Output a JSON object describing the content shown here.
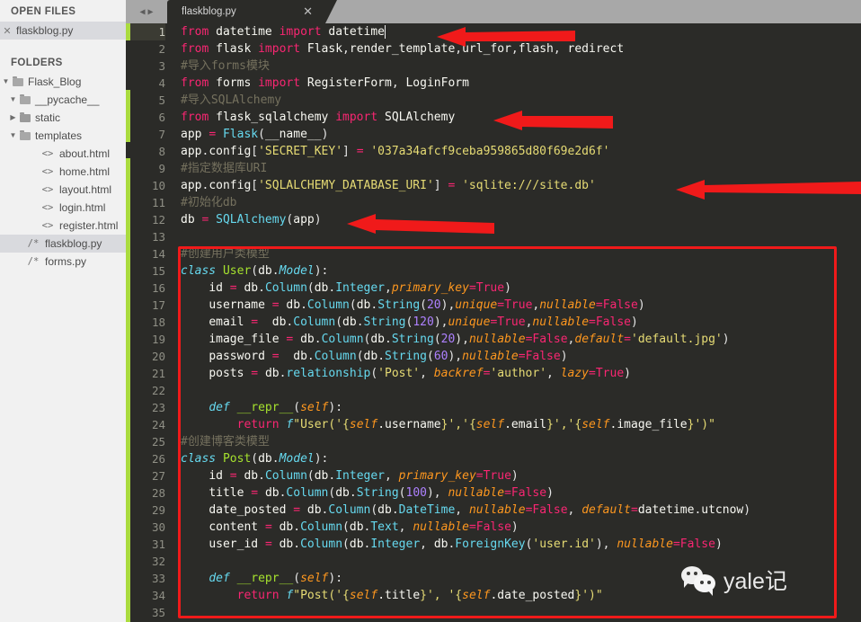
{
  "sidebar": {
    "open_files_title": "OPEN FILES",
    "open_files": [
      {
        "name": "flaskblog.py",
        "close_icon": "close-icon",
        "selected": true
      }
    ],
    "folders_title": "FOLDERS",
    "tree": [
      {
        "label": "Flask_Blog",
        "kind": "folder",
        "depth": 0,
        "expanded": true,
        "icon": "folder-open-icon",
        "triangle": "▼"
      },
      {
        "label": "__pycache__",
        "kind": "folder",
        "depth": 1,
        "expanded": true,
        "icon": "folder-open-icon",
        "triangle": "▼"
      },
      {
        "label": "static",
        "kind": "folder",
        "depth": 1,
        "expanded": false,
        "icon": "folder-closed-icon",
        "triangle": "▶"
      },
      {
        "label": "templates",
        "kind": "folder",
        "depth": 1,
        "expanded": true,
        "icon": "folder-open-icon",
        "triangle": "▼"
      },
      {
        "label": "about.html",
        "kind": "file",
        "depth": 2,
        "icon": "html-file-icon",
        "glyph": "<>"
      },
      {
        "label": "home.html",
        "kind": "file",
        "depth": 2,
        "icon": "html-file-icon",
        "glyph": "<>"
      },
      {
        "label": "layout.html",
        "kind": "file",
        "depth": 2,
        "icon": "html-file-icon",
        "glyph": "<>"
      },
      {
        "label": "login.html",
        "kind": "file",
        "depth": 2,
        "icon": "html-file-icon",
        "glyph": "<>"
      },
      {
        "label": "register.html",
        "kind": "file",
        "depth": 2,
        "icon": "html-file-icon",
        "glyph": "<>"
      },
      {
        "label": "flaskblog.py",
        "kind": "file",
        "depth": 1,
        "icon": "python-file-icon",
        "glyph": "/*",
        "selected": true
      },
      {
        "label": "forms.py",
        "kind": "file",
        "depth": 1,
        "icon": "python-file-icon",
        "glyph": "/*"
      }
    ]
  },
  "tabbar": {
    "nav_back_icon": "chevron-left-icon",
    "nav_forward_icon": "chevron-right-icon",
    "tabs": [
      {
        "label": "flaskblog.py",
        "close_icon": "close-icon",
        "active": true
      }
    ]
  },
  "editor": {
    "first_line": 1,
    "last_line": 35,
    "current_line": 1,
    "cursor_line": 1,
    "cursor_col": 29,
    "line_numbers": [
      "1",
      "2",
      "3",
      "4",
      "5",
      "6",
      "7",
      "8",
      "9",
      "10",
      "11",
      "12",
      "13",
      "14",
      "15",
      "16",
      "17",
      "18",
      "19",
      "20",
      "21",
      "22",
      "23",
      "24",
      "25",
      "26",
      "27",
      "28",
      "29",
      "30",
      "31",
      "32",
      "33",
      "34",
      "35"
    ],
    "lines": [
      "from datetime import datetime",
      "from flask import Flask,render_template,url_for,flash, redirect",
      "#导入forms模块",
      "from forms import RegisterForm, LoginForm",
      "#导入SQLAlchemy",
      "from flask_sqlalchemy import SQLAlchemy",
      "app = Flask(__name__)",
      "app.config['SECRET_KEY'] = '037a34afcf9ceba959865d80f69e2d6f'",
      "#指定数据库URI",
      "app.config['SQLALCHEMY_DATABASE_URI'] = 'sqlite:///site.db'",
      "#初始化db",
      "db = SQLAlchemy(app)",
      "",
      "#创建用户类模型",
      "class User(db.Model):",
      "    id = db.Column(db.Integer,primary_key=True)",
      "    username = db.Column(db.String(20),unique=True,nullable=False)",
      "    email =  db.Column(db.String(120),unique=True,nullable=False)",
      "    image_file = db.Column(db.String(20),nullable=False,default='default.jpg')",
      "    password =  db.Column(db.String(60),nullable=False)",
      "    posts = db.relationship('Post', backref='author', lazy=True)",
      "",
      "    def __repr__(self):",
      "        return f\"User('{self.username}','{self.email}','{self.image_file}')\"",
      "#创建博客类模型",
      "class Post(db.Model):",
      "    id = db.Column(db.Integer, primary_key=True)",
      "    title = db.Column(db.String(100), nullable=False)",
      "    date_posted = db.Column(db.DateTime, nullable=False, default=datetime.utcnow)",
      "    content = db.Column(db.Text, nullable=False)",
      "    user_id = db.Column(db.Integer, db.ForeignKey('user.id'), nullable=False)",
      "",
      "    def __repr__(self):",
      "        return f\"Post('{self.title}', '{self.date_posted}')\"",
      ""
    ]
  },
  "annotations": {
    "highlight_box": {
      "color": "#f01a1a",
      "covers_lines": "14-34",
      "label": "model-definitions-highlight"
    },
    "arrows": [
      {
        "name": "arrow-line-1",
        "points_to_line": 1,
        "color": "#f01a1a"
      },
      {
        "name": "arrow-line-6",
        "points_to_line": 6,
        "color": "#f01a1a"
      },
      {
        "name": "arrow-line-10",
        "points_to_line": 10,
        "color": "#f01a1a"
      },
      {
        "name": "arrow-line-12",
        "points_to_line": 12,
        "color": "#f01a1a"
      }
    ],
    "change_markers_color": "#aadb3f"
  },
  "watermark": {
    "text": "yale记",
    "icon": "wechat-icon"
  },
  "colors": {
    "editor_bg": "#2b2b28",
    "sidebar_bg": "#f1f1f1",
    "tabbar_bg": "#a8a8a8",
    "accent_red": "#f01a1a",
    "accent_green": "#aadb3f",
    "keyword": "#f92672",
    "string": "#e6db74",
    "comment": "#75715e",
    "number": "#ae81ff",
    "type": "#66d9ef",
    "param": "#fd971f",
    "function": "#a6e22e"
  }
}
